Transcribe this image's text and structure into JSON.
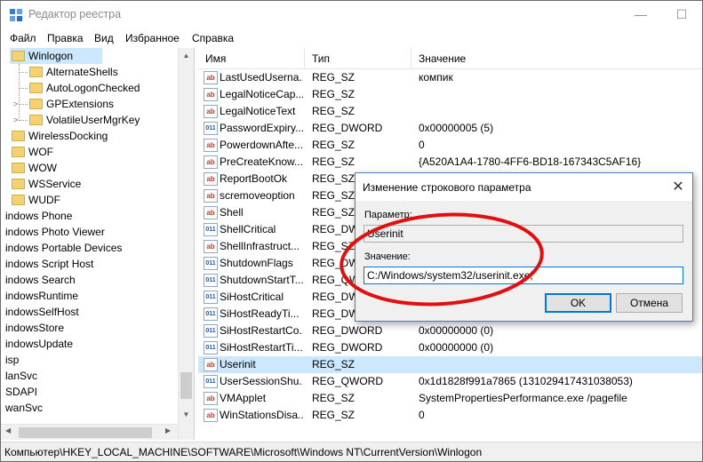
{
  "window": {
    "title": "Редактор реестра",
    "minimize_glyph": "—",
    "maximize_glyph": "☐"
  },
  "menu": [
    "Файл",
    "Правка",
    "Вид",
    "Избранное",
    "Справка"
  ],
  "tree": {
    "items": [
      {
        "label": "Winlogon",
        "selected": true
      },
      {
        "label": "AlternateShells"
      },
      {
        "label": "AutoLogonChecked"
      },
      {
        "label": "GPExtensions"
      },
      {
        "label": "VolatileUserMgrKey"
      },
      {
        "label": "WirelessDocking"
      },
      {
        "label": "WOF"
      },
      {
        "label": "WOW"
      },
      {
        "label": "WSService"
      },
      {
        "label": "WUDF"
      },
      {
        "label": "indows Phone"
      },
      {
        "label": "indows Photo Viewer"
      },
      {
        "label": "indows Portable Devices"
      },
      {
        "label": "indows Script Host"
      },
      {
        "label": "indows Search"
      },
      {
        "label": "indowsRuntime"
      },
      {
        "label": "indowsSelfHost"
      },
      {
        "label": "indowsStore"
      },
      {
        "label": "indowsUpdate"
      },
      {
        "label": "isp"
      },
      {
        "label": "lanSvc"
      },
      {
        "label": "SDAPI"
      },
      {
        "label": "wanSvc"
      }
    ]
  },
  "list": {
    "columns": [
      "Имя",
      "Тип",
      "Значение"
    ],
    "rows": [
      {
        "name": "LastUsedUserna...",
        "type": "REG_SZ",
        "value": "компик",
        "icon": "ab"
      },
      {
        "name": "LegalNoticeCap...",
        "type": "REG_SZ",
        "value": "",
        "icon": "ab"
      },
      {
        "name": "LegalNoticeText",
        "type": "REG_SZ",
        "value": "",
        "icon": "ab"
      },
      {
        "name": "PasswordExpiry...",
        "type": "REG_DWORD",
        "value": "0x00000005 (5)",
        "icon": "bin"
      },
      {
        "name": "PowerdownAfte...",
        "type": "REG_SZ",
        "value": "0",
        "icon": "ab"
      },
      {
        "name": "PreCreateKnow...",
        "type": "REG_SZ",
        "value": "{A520A1A4-1780-4FF6-BD18-167343C5AF16}",
        "icon": "ab"
      },
      {
        "name": "ReportBootOk",
        "type": "REG_SZ",
        "value": "",
        "icon": "ab"
      },
      {
        "name": "scremoveoption",
        "type": "REG_SZ",
        "value": "",
        "icon": "ab"
      },
      {
        "name": "Shell",
        "type": "REG_SZ",
        "value": "",
        "icon": "ab"
      },
      {
        "name": "ShellCritical",
        "type": "REG_DWO",
        "value": "",
        "icon": "bin"
      },
      {
        "name": "ShellInfrastruct...",
        "type": "REG_SZ",
        "value": "",
        "icon": "ab"
      },
      {
        "name": "ShutdownFlags",
        "type": "REG_DWO",
        "value": "",
        "icon": "bin"
      },
      {
        "name": "ShutdownStartT...",
        "type": "REG_QWO",
        "value": "",
        "icon": "bin"
      },
      {
        "name": "SiHostCritical",
        "type": "REG_DWO",
        "value": "",
        "icon": "bin"
      },
      {
        "name": "SiHostReadyTi...",
        "type": "REG_DWO",
        "value": "",
        "icon": "bin"
      },
      {
        "name": "SiHostRestartCo...",
        "type": "REG_DWORD",
        "value": "0x00000000 (0)",
        "icon": "bin"
      },
      {
        "name": "SiHostRestartTi...",
        "type": "REG_DWORD",
        "value": "0x00000000 (0)",
        "icon": "bin"
      },
      {
        "name": "Userinit",
        "type": "REG_SZ",
        "value": "",
        "icon": "ab",
        "selected": true
      },
      {
        "name": "UserSessionShu...",
        "type": "REG_QWORD",
        "value": "0x1d1828f991a7865 (131029417431038053)",
        "icon": "bin"
      },
      {
        "name": "VMApplet",
        "type": "REG_SZ",
        "value": "SystemPropertiesPerformance.exe /pagefile",
        "icon": "ab"
      },
      {
        "name": "WinStationsDisa...",
        "type": "REG_SZ",
        "value": "0",
        "icon": "ab"
      }
    ]
  },
  "statusbar": "Компьютер\\HKEY_LOCAL_MACHINE\\SOFTWARE\\Microsoft\\Windows NT\\CurrentVersion\\Winlogon",
  "dialog": {
    "title": "Изменение строкового параметра",
    "close_glyph": "✕",
    "param_label": "Параметр:",
    "param_value": "Userinit",
    "value_label": "Значение:",
    "value_value": "C:/Windows/system32/userinit.exe,",
    "ok_label": "OK",
    "cancel_label": "Отмена"
  },
  "colors": {
    "selection": "#cce8ff",
    "annotation_ellipse": "#e01010",
    "folder": "#f3d371"
  }
}
